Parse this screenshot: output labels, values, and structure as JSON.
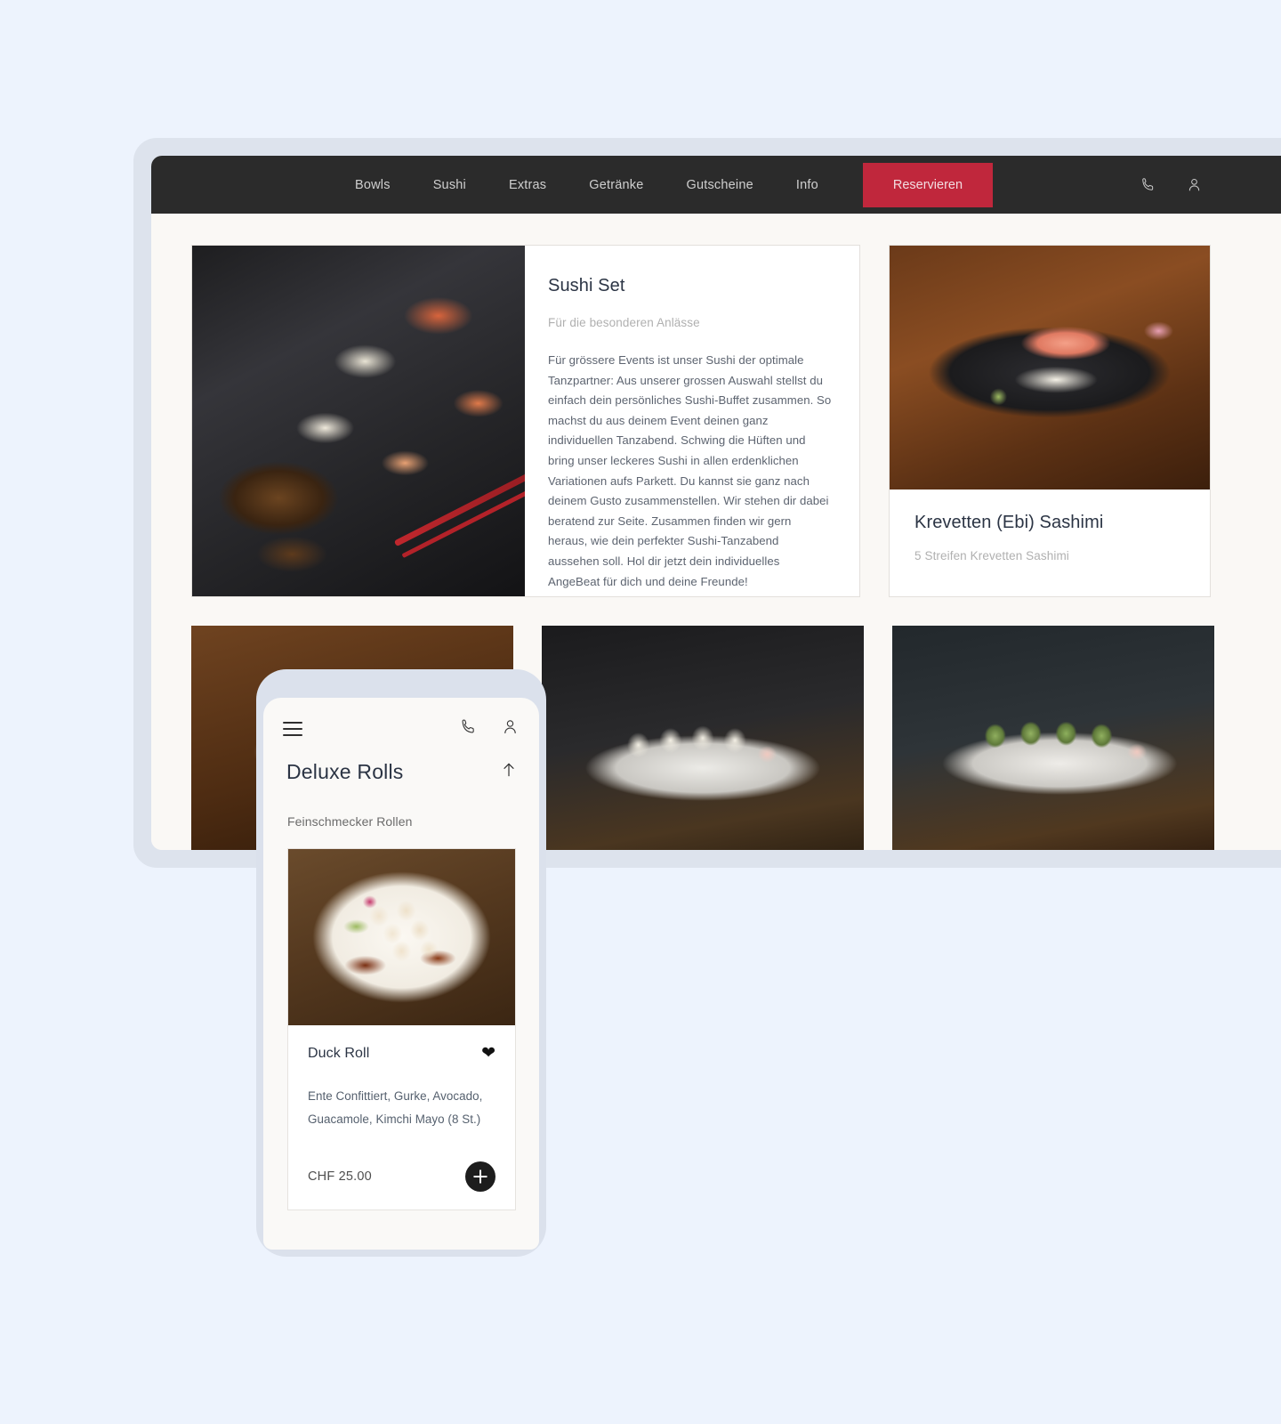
{
  "theme": {
    "page_background": "#edf3fd",
    "bezel": "#dde3ed",
    "nav_background": "#2b2b2b",
    "accent": "#c0273c",
    "content_background": "#faf8f5"
  },
  "desktop": {
    "nav": {
      "links": [
        {
          "label": "Bowls"
        },
        {
          "label": "Sushi"
        },
        {
          "label": "Extras"
        },
        {
          "label": "Getränke"
        },
        {
          "label": "Gutscheine"
        },
        {
          "label": "Info"
        }
      ],
      "cta_label": "Reservieren",
      "icons": [
        {
          "name": "phone-icon"
        },
        {
          "name": "user-icon"
        }
      ]
    },
    "featured_card": {
      "title": "Sushi Set",
      "subtitle": "Für die besonderen Anlässe",
      "description": "Für grössere Events ist unser Sushi der optimale Tanzpartner: Aus unserer grossen Auswahl stellst du einfach dein persönliches Sushi-Buffet zusammen. So machst du aus deinem Event deinen ganz individuellen Tanzabend. Schwing die Hüften und bring unser leckeres Sushi in allen erdenklichen Variationen aufs Parkett. Du kannst sie ganz nach deinem Gusto zusammenstellen. Wir stehen dir dabei beratend zur Seite. Zusammen finden wir gern heraus, wie dein perfekter Sushi-Tanzabend aussehen soll. Hol dir jetzt dein individuelles AngeBeat für dich und deine Freunde!",
      "photo": "sushi-platter-photo"
    },
    "side_card": {
      "title": "Krevetten (Ebi) Sashimi",
      "subtitle": "5 Streifen Krevetten Sashimi",
      "photo": "ebi-sashimi-photo"
    },
    "thumbnails": [
      {
        "photo": "nigiri-plate-photo"
      },
      {
        "photo": "california-rolls-photo"
      },
      {
        "photo": "cucumber-rolls-photo"
      }
    ]
  },
  "phone": {
    "topbar": {
      "menu_icon": "hamburger-menu-icon",
      "phone_icon": "phone-icon",
      "user_icon": "user-icon"
    },
    "heading": "Deluxe Rolls",
    "scroll_top_icon": "arrow-up-icon",
    "section_subtitle": "Feinschmecker Rollen",
    "item": {
      "name": "Duck Roll",
      "favorite_icon": "heart-icon",
      "description": "Ente Confittiert, Gurke, Avocado, Guacamole, Kimchi Mayo (8 St.)",
      "price": "CHF 25.00",
      "add_icon": "plus-icon",
      "photo": "duck-roll-photo"
    }
  }
}
